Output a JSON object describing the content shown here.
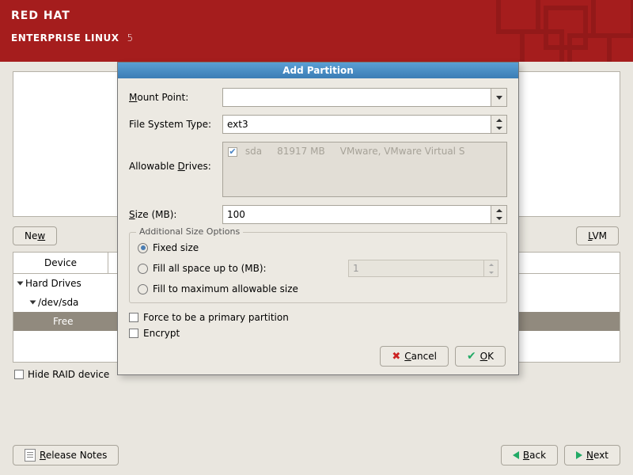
{
  "header": {
    "line1": "RED HAT",
    "line2": "ENTERPRISE LINUX",
    "version": "5"
  },
  "buttons": {
    "new": "New",
    "lvm": "LVM",
    "release_notes": "Release Notes",
    "back": "Back",
    "next": "Next",
    "cancel": "Cancel",
    "ok": "OK"
  },
  "device_panel": {
    "header": "Device",
    "hard_drives": "Hard Drives",
    "dev_sda": "/dev/sda",
    "free": "Free"
  },
  "hide_raid": "Hide RAID device",
  "dialog": {
    "title": "Add Partition",
    "mount_point_label": "Mount Point:",
    "fs_type_label": "File System Type:",
    "fs_type_value": "ext3",
    "allowable_drives_label": "Allowable Drives:",
    "drive_entry": {
      "name": "sda",
      "size": "81917 MB",
      "model": "VMware, VMware Virtual S"
    },
    "size_label": "Size (MB):",
    "size_value": "100",
    "additional_legend": "Additional Size Options",
    "opt_fixed": "Fixed size",
    "opt_fill_up": "Fill all space up to (MB):",
    "opt_fill_up_value": "1",
    "opt_fill_max": "Fill to maximum allowable size",
    "force_primary": "Force to be a primary partition",
    "encrypt": "Encrypt"
  }
}
